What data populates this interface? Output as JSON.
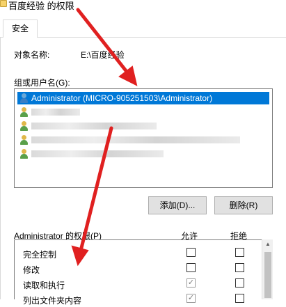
{
  "window": {
    "title": "百度经验 的权限",
    "icon": "folder-icon"
  },
  "tabs": [
    {
      "label": "安全"
    }
  ],
  "object": {
    "label": "对象名称:",
    "value": "E:\\百度经验"
  },
  "groups": {
    "label": "组或用户名(G):",
    "items": [
      {
        "label": "Administrator (MICRO-905251503\\Administrator)",
        "selected": true,
        "icon": "user-icon"
      },
      {
        "label": "",
        "redacted": true,
        "icon": "user-group-icon"
      },
      {
        "label": "",
        "redacted": true,
        "icon": "user-group-icon"
      },
      {
        "label": "",
        "redacted": true,
        "icon": "user-group-icon"
      },
      {
        "label": "",
        "redacted": true,
        "icon": "user-group-icon"
      }
    ]
  },
  "buttons": {
    "add": "添加(D)...",
    "remove": "删除(R)"
  },
  "permissions": {
    "title": "Administrator 的权限(P)",
    "allow_label": "允许",
    "deny_label": "拒绝",
    "rows": [
      {
        "name": "完全控制",
        "allow": false,
        "deny": false
      },
      {
        "name": "修改",
        "allow": false,
        "deny": false
      },
      {
        "name": "读取和执行",
        "allow": true,
        "deny": false
      },
      {
        "name": "列出文件夹内容",
        "allow": true,
        "deny": false
      }
    ]
  },
  "annotation_color": "#e02020"
}
